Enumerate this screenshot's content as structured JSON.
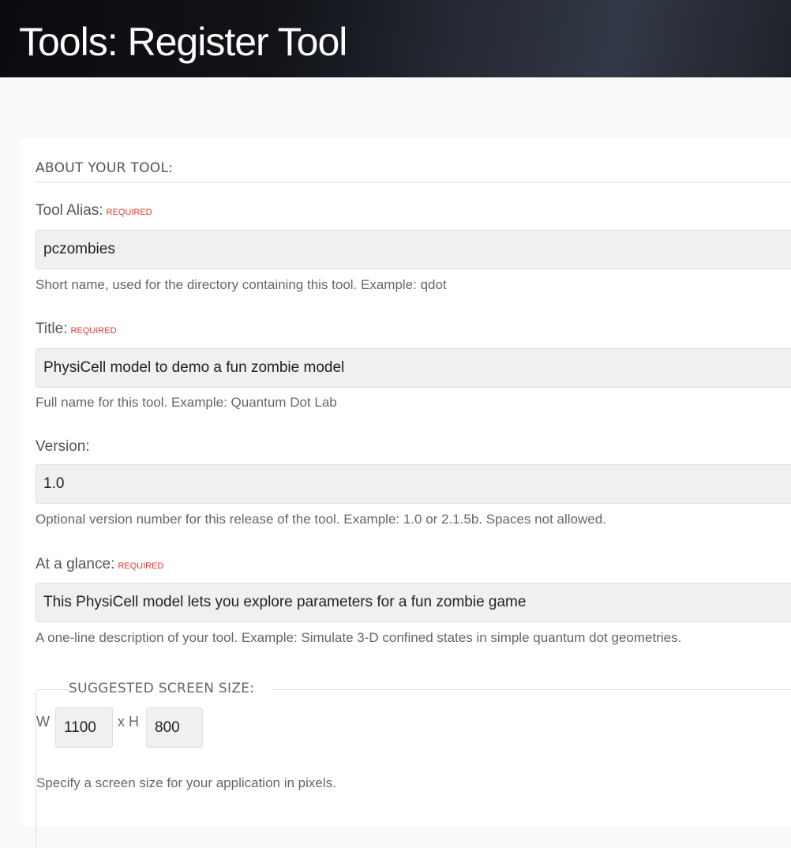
{
  "header": {
    "title": "Tools: Register Tool"
  },
  "form": {
    "section_title": "ABOUT YOUR TOOL:",
    "required_label": "REQUIRED",
    "alias": {
      "label": "Tool Alias:",
      "value": "pczombies",
      "hint": "Short name, used for the directory containing this tool. Example: qdot"
    },
    "title": {
      "label": "Title:",
      "value": "PhysiCell model to demo a fun zombie model",
      "hint": "Full name for this tool. Example: Quantum Dot Lab"
    },
    "version": {
      "label": "Version:",
      "value": "1.0",
      "hint": "Optional version number for this release of the tool. Example: 1.0 or 2.1.5b. Spaces not allowed."
    },
    "glance": {
      "label": "At a glance:",
      "value": "This PhysiCell model lets you explore parameters for a fun zombie game",
      "hint": "A one-line description of your tool. Example: Simulate 3-D confined states in simple quantum dot geometries."
    },
    "screen_size": {
      "legend": "SUGGESTED SCREEN SIZE:",
      "w_label": "W",
      "width": "1100",
      "h_label": "x H",
      "height": "800",
      "hint": "Specify a screen size for your application in pixels."
    }
  }
}
